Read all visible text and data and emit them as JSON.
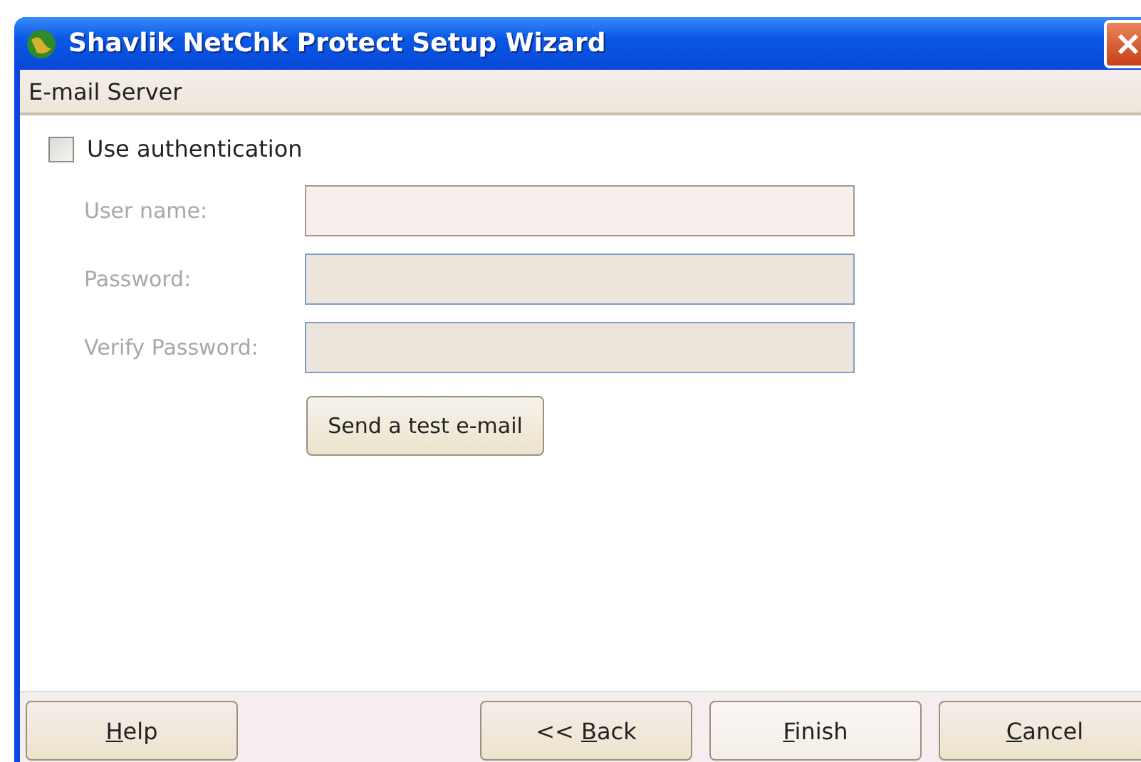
{
  "window": {
    "title": "Shavlik NetChk Protect Setup Wizard"
  },
  "page": {
    "heading": "E-mail Server"
  },
  "use_authentication": {
    "label": "Use authentication",
    "checked": false
  },
  "fields": [
    {
      "label": "User name:",
      "disabled": true
    },
    {
      "label": "Password:",
      "disabled": true
    },
    {
      "label": "Verify Password:",
      "disabled": true
    }
  ],
  "test_button": {
    "label": "Send a test e-mail"
  },
  "buttons": [
    {
      "key": "H",
      "after": "elp",
      "default": false
    },
    {
      "before": "<< ",
      "key": "B",
      "after": "ack",
      "default": false
    },
    {
      "key": "F",
      "after": "inish",
      "default": true
    },
    {
      "key": "C",
      "after": "ancel",
      "default": false
    }
  ]
}
